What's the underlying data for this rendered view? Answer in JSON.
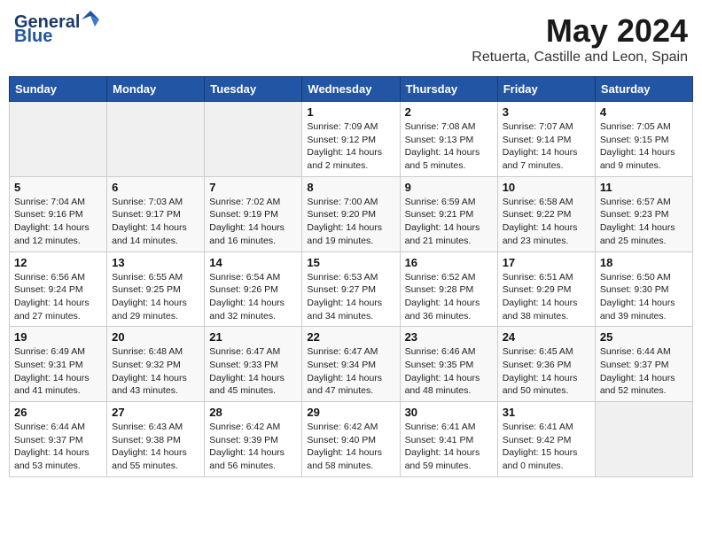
{
  "header": {
    "logo_line1": "General",
    "logo_line2": "Blue",
    "main_title": "May 2024",
    "subtitle": "Retuerta, Castille and Leon, Spain"
  },
  "calendar": {
    "weekdays": [
      "Sunday",
      "Monday",
      "Tuesday",
      "Wednesday",
      "Thursday",
      "Friday",
      "Saturday"
    ],
    "weeks": [
      [
        {
          "day": "",
          "content": ""
        },
        {
          "day": "",
          "content": ""
        },
        {
          "day": "",
          "content": ""
        },
        {
          "day": "1",
          "content": "Sunrise: 7:09 AM\nSunset: 9:12 PM\nDaylight: 14 hours\nand 2 minutes."
        },
        {
          "day": "2",
          "content": "Sunrise: 7:08 AM\nSunset: 9:13 PM\nDaylight: 14 hours\nand 5 minutes."
        },
        {
          "day": "3",
          "content": "Sunrise: 7:07 AM\nSunset: 9:14 PM\nDaylight: 14 hours\nand 7 minutes."
        },
        {
          "day": "4",
          "content": "Sunrise: 7:05 AM\nSunset: 9:15 PM\nDaylight: 14 hours\nand 9 minutes."
        }
      ],
      [
        {
          "day": "5",
          "content": "Sunrise: 7:04 AM\nSunset: 9:16 PM\nDaylight: 14 hours\nand 12 minutes."
        },
        {
          "day": "6",
          "content": "Sunrise: 7:03 AM\nSunset: 9:17 PM\nDaylight: 14 hours\nand 14 minutes."
        },
        {
          "day": "7",
          "content": "Sunrise: 7:02 AM\nSunset: 9:19 PM\nDaylight: 14 hours\nand 16 minutes."
        },
        {
          "day": "8",
          "content": "Sunrise: 7:00 AM\nSunset: 9:20 PM\nDaylight: 14 hours\nand 19 minutes."
        },
        {
          "day": "9",
          "content": "Sunrise: 6:59 AM\nSunset: 9:21 PM\nDaylight: 14 hours\nand 21 minutes."
        },
        {
          "day": "10",
          "content": "Sunrise: 6:58 AM\nSunset: 9:22 PM\nDaylight: 14 hours\nand 23 minutes."
        },
        {
          "day": "11",
          "content": "Sunrise: 6:57 AM\nSunset: 9:23 PM\nDaylight: 14 hours\nand 25 minutes."
        }
      ],
      [
        {
          "day": "12",
          "content": "Sunrise: 6:56 AM\nSunset: 9:24 PM\nDaylight: 14 hours\nand 27 minutes."
        },
        {
          "day": "13",
          "content": "Sunrise: 6:55 AM\nSunset: 9:25 PM\nDaylight: 14 hours\nand 29 minutes."
        },
        {
          "day": "14",
          "content": "Sunrise: 6:54 AM\nSunset: 9:26 PM\nDaylight: 14 hours\nand 32 minutes."
        },
        {
          "day": "15",
          "content": "Sunrise: 6:53 AM\nSunset: 9:27 PM\nDaylight: 14 hours\nand 34 minutes."
        },
        {
          "day": "16",
          "content": "Sunrise: 6:52 AM\nSunset: 9:28 PM\nDaylight: 14 hours\nand 36 minutes."
        },
        {
          "day": "17",
          "content": "Sunrise: 6:51 AM\nSunset: 9:29 PM\nDaylight: 14 hours\nand 38 minutes."
        },
        {
          "day": "18",
          "content": "Sunrise: 6:50 AM\nSunset: 9:30 PM\nDaylight: 14 hours\nand 39 minutes."
        }
      ],
      [
        {
          "day": "19",
          "content": "Sunrise: 6:49 AM\nSunset: 9:31 PM\nDaylight: 14 hours\nand 41 minutes."
        },
        {
          "day": "20",
          "content": "Sunrise: 6:48 AM\nSunset: 9:32 PM\nDaylight: 14 hours\nand 43 minutes."
        },
        {
          "day": "21",
          "content": "Sunrise: 6:47 AM\nSunset: 9:33 PM\nDaylight: 14 hours\nand 45 minutes."
        },
        {
          "day": "22",
          "content": "Sunrise: 6:47 AM\nSunset: 9:34 PM\nDaylight: 14 hours\nand 47 minutes."
        },
        {
          "day": "23",
          "content": "Sunrise: 6:46 AM\nSunset: 9:35 PM\nDaylight: 14 hours\nand 48 minutes."
        },
        {
          "day": "24",
          "content": "Sunrise: 6:45 AM\nSunset: 9:36 PM\nDaylight: 14 hours\nand 50 minutes."
        },
        {
          "day": "25",
          "content": "Sunrise: 6:44 AM\nSunset: 9:37 PM\nDaylight: 14 hours\nand 52 minutes."
        }
      ],
      [
        {
          "day": "26",
          "content": "Sunrise: 6:44 AM\nSunset: 9:37 PM\nDaylight: 14 hours\nand 53 minutes."
        },
        {
          "day": "27",
          "content": "Sunrise: 6:43 AM\nSunset: 9:38 PM\nDaylight: 14 hours\nand 55 minutes."
        },
        {
          "day": "28",
          "content": "Sunrise: 6:42 AM\nSunset: 9:39 PM\nDaylight: 14 hours\nand 56 minutes."
        },
        {
          "day": "29",
          "content": "Sunrise: 6:42 AM\nSunset: 9:40 PM\nDaylight: 14 hours\nand 58 minutes."
        },
        {
          "day": "30",
          "content": "Sunrise: 6:41 AM\nSunset: 9:41 PM\nDaylight: 14 hours\nand 59 minutes."
        },
        {
          "day": "31",
          "content": "Sunrise: 6:41 AM\nSunset: 9:42 PM\nDaylight: 15 hours\nand 0 minutes."
        },
        {
          "day": "",
          "content": ""
        }
      ]
    ]
  }
}
